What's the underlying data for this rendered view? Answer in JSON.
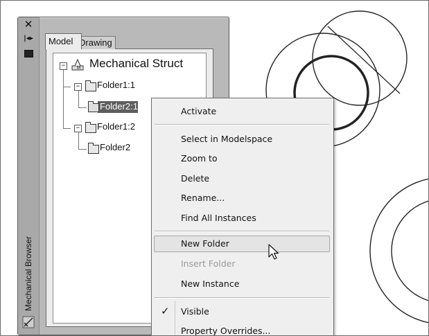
{
  "palette": {
    "close_glyph": "✕",
    "autohide_glyph": "|◂▸",
    "title": "Mechanical Browser",
    "tabs": [
      {
        "label": "Model",
        "active": true
      },
      {
        "label": "Drawing",
        "active": false
      }
    ]
  },
  "tree": {
    "root": {
      "label": "Mechanical Struct",
      "expander": "⊟",
      "icon": "assembly-icon"
    },
    "nodes": [
      {
        "label": "Folder1:1",
        "expander": "⊟",
        "selected": false
      },
      {
        "label": "Folder2:1",
        "expander": "",
        "selected": true
      },
      {
        "label": "Folder1:2",
        "expander": "⊟",
        "selected": false
      },
      {
        "label": "Folder2",
        "expander": "",
        "selected": false
      }
    ]
  },
  "context_menu": {
    "items": [
      {
        "label": "Activate",
        "enabled": true
      },
      {
        "label": "Select in Modelspace",
        "enabled": true
      },
      {
        "label": "Zoom to",
        "enabled": true
      },
      {
        "label": "Delete",
        "enabled": true
      },
      {
        "label": "Rename...",
        "enabled": true
      },
      {
        "label": "Find All Instances",
        "enabled": true
      },
      {
        "label": "New Folder",
        "enabled": true,
        "hovered": true
      },
      {
        "label": "Insert Folder",
        "enabled": false
      },
      {
        "label": "New Instance",
        "enabled": true
      },
      {
        "label": "Visible",
        "enabled": true,
        "checked": true
      },
      {
        "label": "Property Overrides...",
        "enabled": true
      }
    ],
    "check_glyph": "✓"
  },
  "colors": {
    "panel": "#b9b9b9",
    "selection": "#5e5e5e",
    "menu_bg": "#efefef",
    "disabled_text": "#9a9a9a"
  }
}
